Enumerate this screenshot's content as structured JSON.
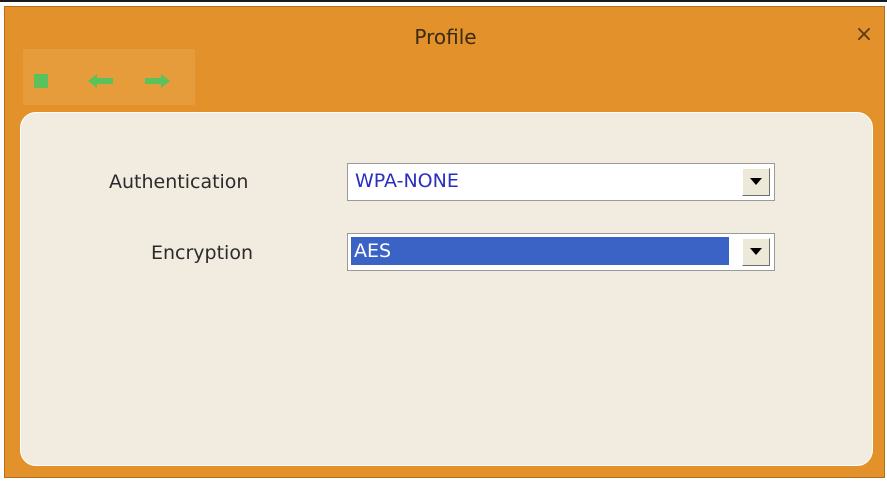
{
  "window": {
    "title": "Profile",
    "close_glyph": "×",
    "frame_color": "#e3912a",
    "panel_color": "#f2ebe0"
  },
  "toolbar": {
    "buttons": [
      {
        "icon": "stop-square-icon",
        "color": "#5bc15b"
      },
      {
        "icon": "back-arrow-icon",
        "color": "#5bc15b"
      },
      {
        "icon": "forward-arrow-icon",
        "color": "#5bc15b"
      }
    ]
  },
  "form": {
    "authentication": {
      "label": "Authentication",
      "value": "WPA-NONE"
    },
    "encryption": {
      "label": "Encryption",
      "value": "AES"
    }
  }
}
